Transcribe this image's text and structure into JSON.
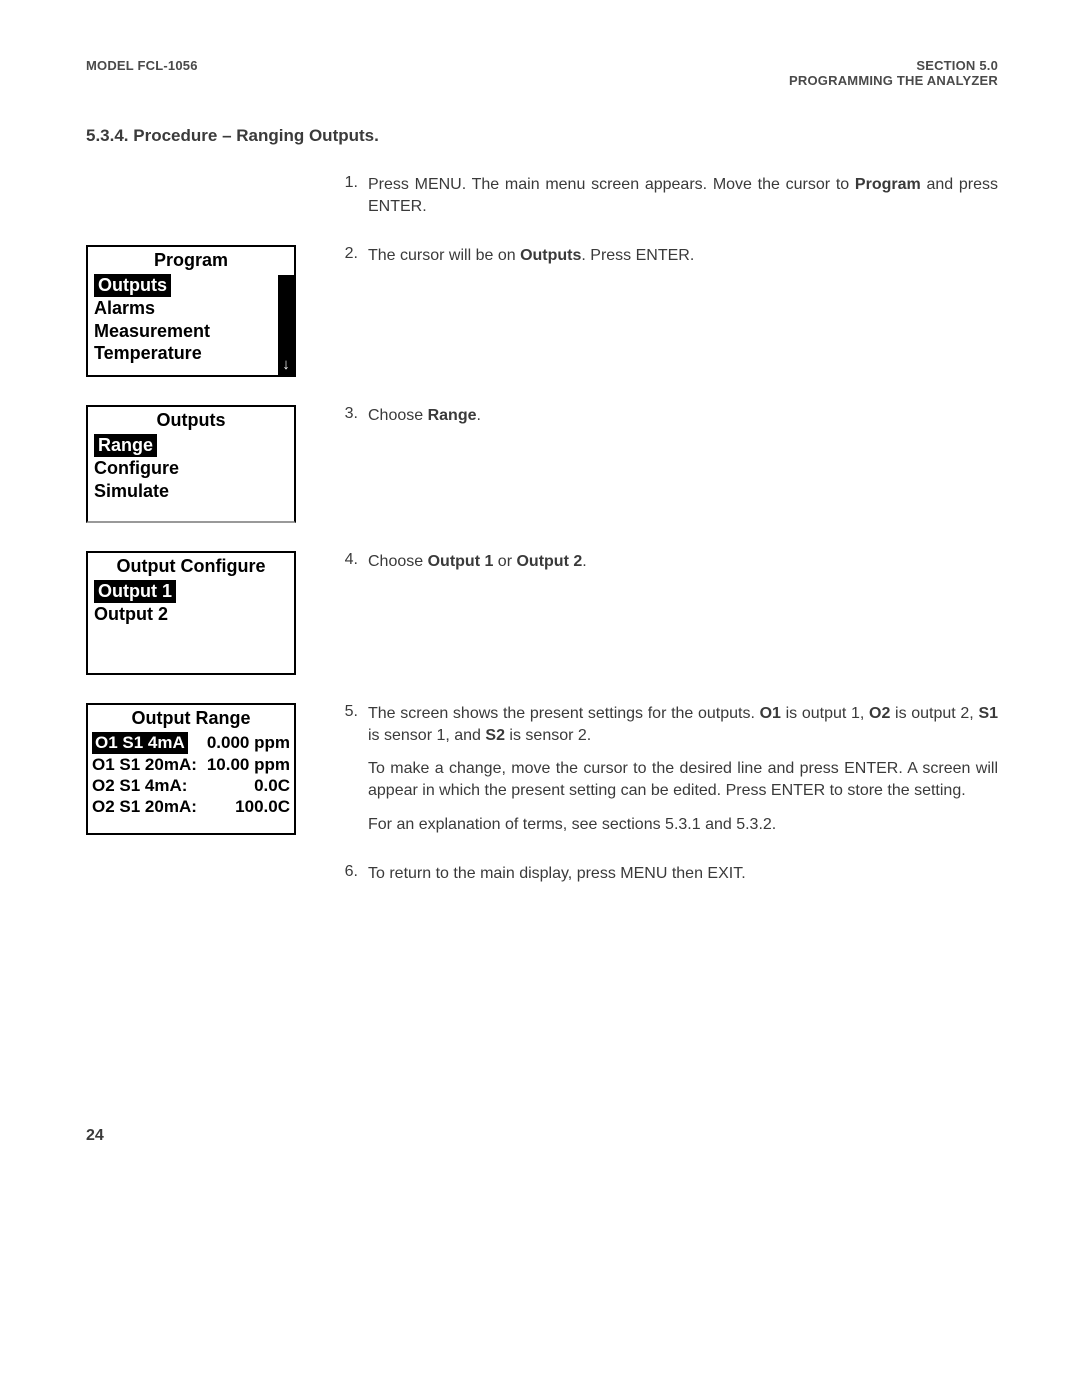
{
  "header": {
    "left": "MODEL FCL-1056",
    "right_line1": "SECTION 5.0",
    "right_line2": "PROGRAMMING THE ANALYZER"
  },
  "section_title": "5.3.4. Procedure – Ranging Outputs.",
  "steps": {
    "s1": {
      "num": "1.",
      "pre": "Press MENU. The main menu screen appears. Move the cursor to ",
      "bold": "Program",
      "post": " and press ENTER."
    },
    "s2": {
      "num": "2.",
      "pre": "The cursor will be on ",
      "bold": "Outputs",
      "post": ". Press ENTER."
    },
    "s3": {
      "num": "3.",
      "pre": "Choose ",
      "bold": "Range",
      "post": "."
    },
    "s4": {
      "num": "4.",
      "pre": "Choose ",
      "bold1": "Output 1",
      "mid": " or ",
      "bold2": "Output 2",
      "post": "."
    },
    "s5": {
      "num": "5.",
      "p1_a": "The screen shows the present settings for the outputs. ",
      "p1_b1": "O1",
      "p1_c": " is output 1, ",
      "p1_b2": "O2",
      "p1_d": " is output 2, ",
      "p1_b3": "S1",
      "p1_e": " is sensor 1, and ",
      "p1_b4": "S2",
      "p1_f": " is sensor 2.",
      "p2": "To make a change, move the cursor to the desired line and press ENTER. A screen will appear in which the present setting can be edited. Press ENTER to store the setting.",
      "p3": "For an explanation of terms, see sections 5.3.1 and 5.3.2."
    },
    "s6": {
      "num": "6.",
      "text": "To return to the main display, press MENU then EXIT."
    }
  },
  "screens": {
    "program": {
      "title": "Program",
      "items": [
        "Outputs",
        "Alarms",
        "Measurement",
        "Temperature"
      ],
      "arrow": "↓"
    },
    "outputs": {
      "title": "Outputs",
      "items": [
        "Range",
        "Configure",
        "Simulate"
      ]
    },
    "output_configure": {
      "title": "Output  Configure",
      "items": [
        "Output 1",
        "Output 2"
      ]
    },
    "output_range": {
      "title": "Output Range",
      "rows": [
        {
          "label": "O1 S1 4mA",
          "value": "0.000 ppm"
        },
        {
          "label": "O1 S1 20mA:",
          "value": "10.00 ppm"
        },
        {
          "label": "O2 S1 4mA:",
          "value": "0.0C"
        },
        {
          "label": "O2 S1 20mA:",
          "value": "100.0C"
        }
      ]
    }
  },
  "page_number": "24"
}
